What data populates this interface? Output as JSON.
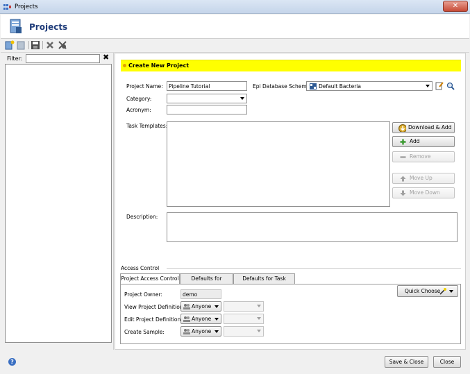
{
  "window": {
    "title": "Projects"
  },
  "header": {
    "title": "Projects"
  },
  "toolbar": {
    "icons": [
      "new-project-icon",
      "delete-project-icon",
      "save-icon",
      "remove-icon",
      "settings-icon"
    ]
  },
  "filter": {
    "label": "Filter:",
    "value": "",
    "clear_icon": "✖"
  },
  "form": {
    "banner_title": "Create New Project",
    "project_name_label": "Project Name:",
    "project_name_value": "Pipeline Tutorial",
    "epi_scheme_label": "Epi Database Scheme:",
    "epi_scheme_value": "Default Bacteria",
    "category_label": "Category:",
    "category_value": "",
    "acronym_label": "Acronym:",
    "acronym_value": "",
    "task_templates_label": "Task Templates:",
    "description_label": "Description:",
    "buttons": {
      "download_add": "Download & Add",
      "add": "Add",
      "remove": "Remove",
      "move_up": "Move Up",
      "move_down": "Move Down"
    }
  },
  "access": {
    "section_label": "Access Control",
    "tabs": [
      "Project Access Control",
      "Defaults for Samples",
      "Defaults for Task Entries"
    ],
    "owner_label": "Project Owner:",
    "owner_value": "demo",
    "quick_choose": "Quick Choose",
    "rows": [
      {
        "label": "View Project Definition:",
        "value": "Anyone"
      },
      {
        "label": "Edit Project Definition:",
        "value": "Anyone"
      },
      {
        "label": "Create Sample:",
        "value": "Anyone"
      }
    ]
  },
  "footer": {
    "save_close": "Save & Close",
    "close": "Close",
    "help": "?"
  },
  "colors": {
    "banner": "#ffff00",
    "header_title": "#1f3c7a",
    "close_button": "#c74a36"
  }
}
